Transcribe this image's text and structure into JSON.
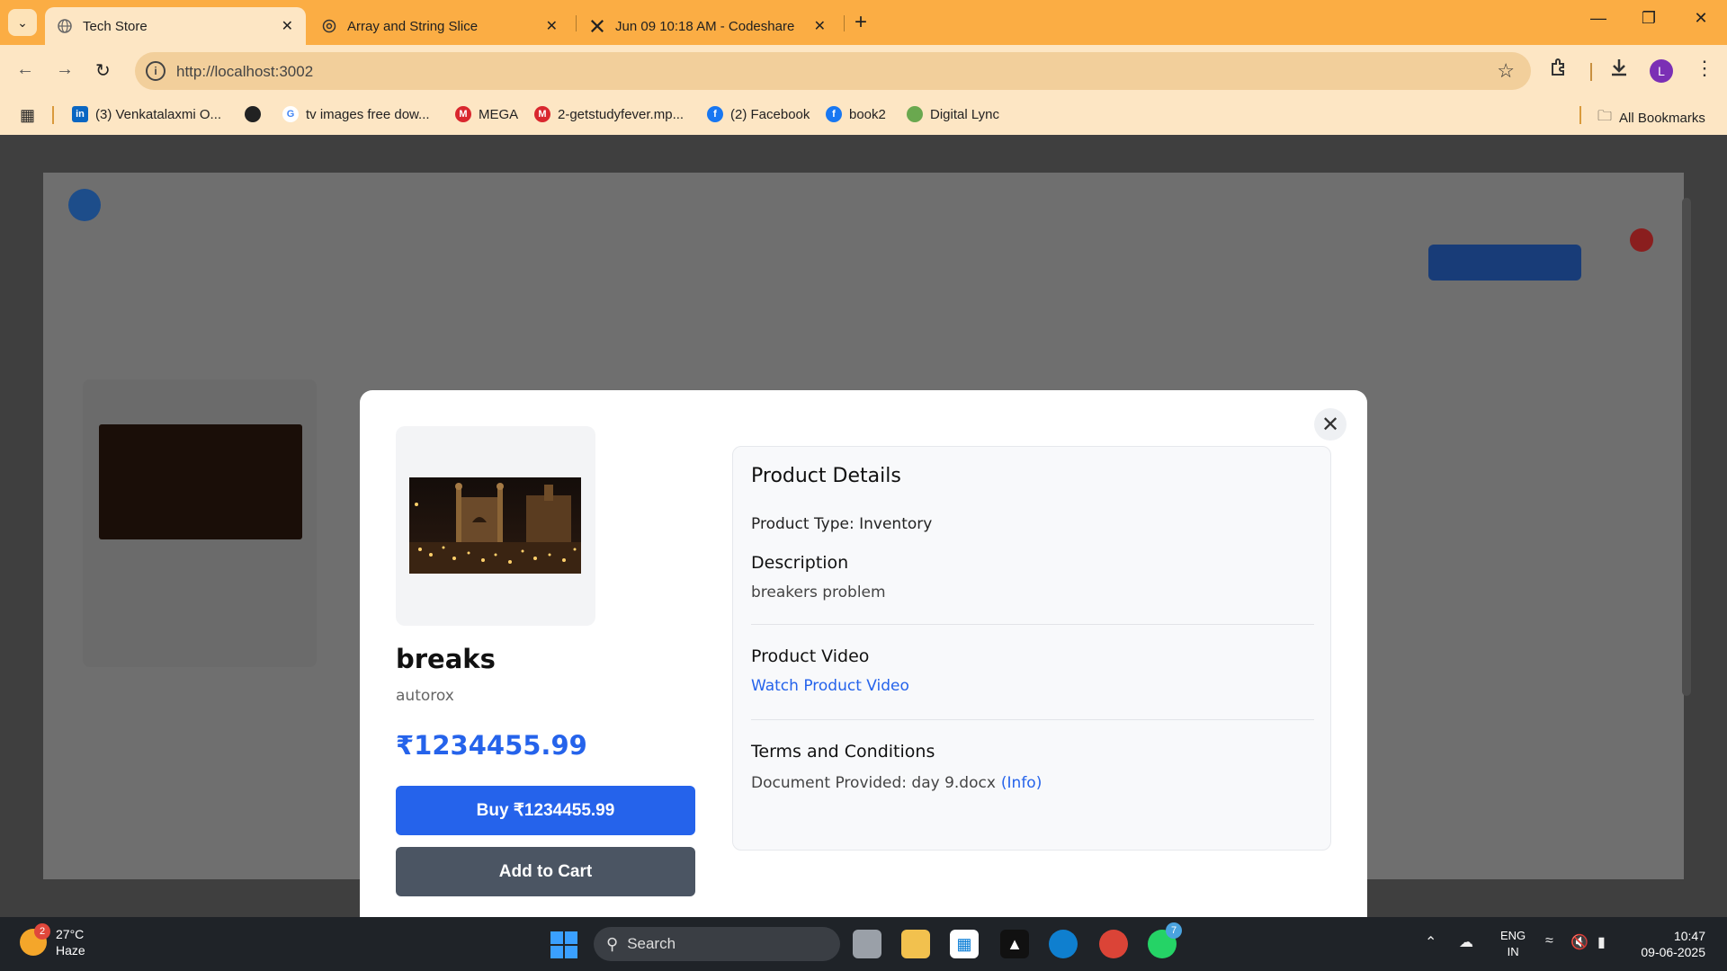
{
  "browser": {
    "tabs": [
      {
        "label": "Tech Store",
        "icon": "globe-icon"
      },
      {
        "label": "Array and String Slice",
        "icon": "openai-icon"
      },
      {
        "label": "Jun 09 10:18 AM - Codeshare",
        "icon": "codeshare-icon"
      }
    ],
    "url": "http://localhost:3002",
    "avatar_letter": "L",
    "bookmarks": [
      {
        "label": "(3) Venkatalaxmi O...",
        "icon": "linkedin-icon",
        "color": "#0a66c2"
      },
      {
        "label": "",
        "icon": "globe-icon",
        "color": "#222222"
      },
      {
        "label": "tv images free dow...",
        "icon": "google-icon",
        "color": "#4285f4"
      },
      {
        "label": "MEGA",
        "icon": "mega-icon",
        "color": "#d9272e"
      },
      {
        "label": "2-getstudyfever.mp...",
        "icon": "mega-icon",
        "color": "#d9272e"
      },
      {
        "label": "(2) Facebook",
        "icon": "facebook-icon",
        "color": "#1877f2"
      },
      {
        "label": "book2",
        "icon": "facebook-icon",
        "color": "#1877f2"
      },
      {
        "label": "Digital Lync",
        "icon": "digital-lync-icon",
        "color": "#6aa84f"
      }
    ],
    "all_bookmarks": "All Bookmarks"
  },
  "modal": {
    "product_name": "breaks",
    "brand": "autorox",
    "price": "₹1234455.99",
    "buy_label": "Buy ₹1234455.99",
    "cart_label": "Add to Cart",
    "details": {
      "title": "Product Details",
      "type_line": "Product Type: Inventory",
      "description_heading": "Description",
      "description": "breakers problem",
      "video_heading": "Product Video",
      "video_link": "Watch Product Video",
      "terms_heading": "Terms and Conditions",
      "document": "Document Provided: day 9.docx",
      "info_link": "(Info)"
    }
  },
  "taskbar": {
    "weather_badge": "2",
    "temperature": "27°C",
    "condition": "Haze",
    "search": "Search",
    "whatsapp_badge": "7",
    "lang_line1": "ENG",
    "lang_line2": "IN",
    "time": "10:47",
    "date": "09-06-2025"
  }
}
